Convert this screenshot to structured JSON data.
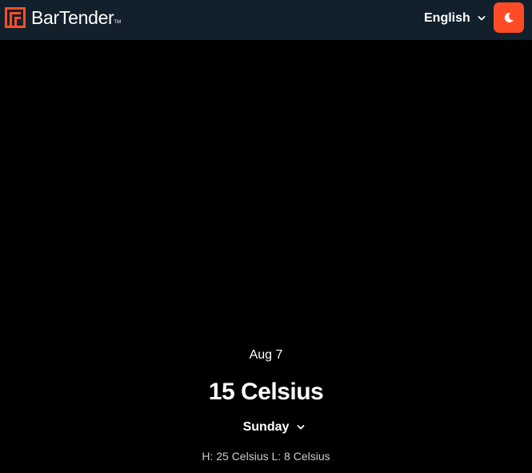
{
  "header": {
    "brand": "BarTender",
    "brand_mark": "TM",
    "language": "English",
    "theme_toggle_icon": "moon-icon",
    "accent_color": "#ff4c27",
    "header_bg": "#12202c"
  },
  "weather": {
    "date": "Aug 7",
    "temperature": "15 Celsius",
    "day_selected": "Sunday",
    "hi_lo": "H: 25 Celsius L: 8 Celsius"
  }
}
